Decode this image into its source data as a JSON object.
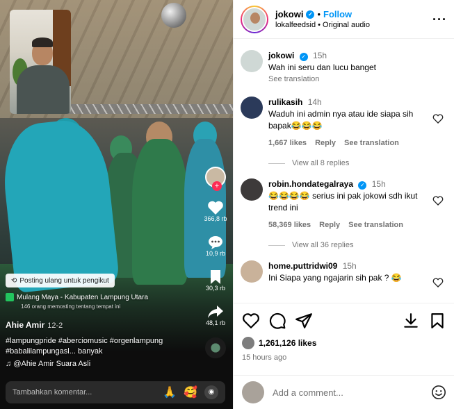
{
  "video": {
    "repost_label": "Posting ulang untuk pengikut",
    "location": "Mulang Maya - Kabupaten Lampung Utara",
    "location_sub": "146 orang memosting tentang tempat ini",
    "author": "Ahie Amir",
    "author_date": "12-2",
    "hashtags": "#lampungpride #aberciomusic #orgenlampung #babalilampungasl...",
    "hashtags_more": "banyak",
    "music": "@Ahie Amir Suara Asli",
    "likes": "366,8 rb",
    "comments": "10,9 rb",
    "saves": "30,3 rb",
    "shares": "48,1 rb",
    "comment_placeholder": "Tambahkan komentar...",
    "emoji1": "🙏",
    "emoji2": "🥰"
  },
  "header": {
    "username": "jokowi",
    "follow_label": "Follow",
    "subtitle": "lokalfeedsid • Original audio"
  },
  "comments": [
    {
      "user": "jokowi",
      "time": "15h",
      "text": "Wah ini seru dan lucu banget",
      "translation": "See translation"
    },
    {
      "user": "rulikasih",
      "time": "14h",
      "text": "Waduh ini admin nya atau ide siapa sih bapak😂😂😂",
      "likes": "1,667 likes",
      "reply": "Reply",
      "translation": "See translation",
      "replies": "View all 8 replies"
    },
    {
      "user": "robin.hondategalraya",
      "time": "15h",
      "text": "😂😂😂😂 serius ini pak jokowi sdh ikut trend ini",
      "likes": "58,369 likes",
      "reply": "Reply",
      "translation": "See translation",
      "replies": "View all 36 replies"
    },
    {
      "user": "home.puttridwi09",
      "time": "15h",
      "text": "Ini Siapa yang ngajarin sih pak ? 😂"
    }
  ],
  "post": {
    "likes": "1,261,126 likes",
    "time_ago": "15 hours ago",
    "add_comment_placeholder": "Add a comment..."
  },
  "colors": {
    "accent": "#0095f6",
    "muted": "#737373"
  }
}
